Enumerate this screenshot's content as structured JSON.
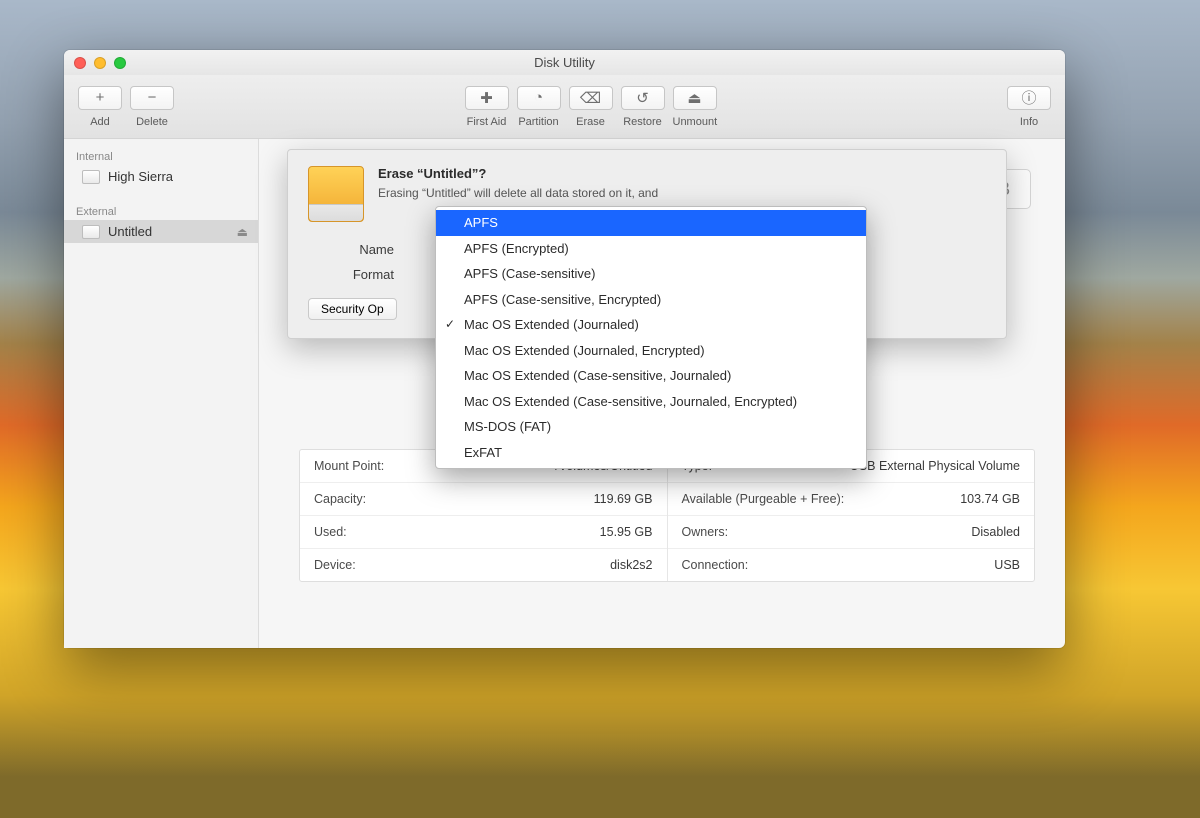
{
  "window": {
    "title": "Disk Utility"
  },
  "toolbar": {
    "add": "Add",
    "delete": "Delete",
    "first_aid": "First Aid",
    "partition": "Partition",
    "erase": "Erase",
    "restore": "Restore",
    "unmount": "Unmount",
    "info": "Info"
  },
  "sidebar": {
    "internal_header": "Internal",
    "external_header": "External",
    "internal_items": [
      {
        "label": "High Sierra"
      }
    ],
    "external_items": [
      {
        "label": "Untitled"
      }
    ]
  },
  "sheet": {
    "title": "Erase “Untitled”?",
    "description": "Erasing “Untitled” will delete all data stored on it, and",
    "name_label": "Name",
    "format_label": "Format",
    "security_button": "Security Op"
  },
  "dropdown": {
    "options": [
      "APFS",
      "APFS (Encrypted)",
      "APFS (Case-sensitive)",
      "APFS (Case-sensitive, Encrypted)",
      "Mac OS Extended (Journaled)",
      "Mac OS Extended (Journaled, Encrypted)",
      "Mac OS Extended (Case-sensitive, Journaled)",
      "Mac OS Extended (Case-sensitive, Journaled, Encrypted)",
      "MS-DOS (FAT)",
      "ExFAT"
    ],
    "highlighted_index": 0,
    "checked_index": 4
  },
  "size_tag": "119.69 GB",
  "details": {
    "left": [
      {
        "k": "Mount Point:",
        "v": "/Volumes/Untitled"
      },
      {
        "k": "Capacity:",
        "v": "119.69 GB"
      },
      {
        "k": "Used:",
        "v": "15.95 GB"
      },
      {
        "k": "Device:",
        "v": "disk2s2"
      }
    ],
    "right": [
      {
        "k": "Type:",
        "v": "USB External Physical Volume"
      },
      {
        "k": "Available (Purgeable + Free):",
        "v": "103.74 GB"
      },
      {
        "k": "Owners:",
        "v": "Disabled"
      },
      {
        "k": "Connection:",
        "v": "USB"
      }
    ]
  }
}
